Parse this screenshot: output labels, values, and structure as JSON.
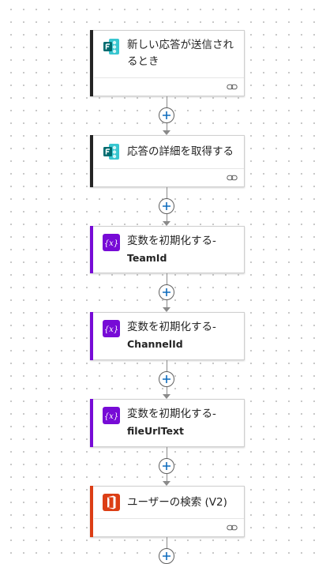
{
  "flow": {
    "steps": [
      {
        "title": "新しい応答が送信されるとき",
        "title_line1": "新しい応答が送信され",
        "title_line2": "るとき",
        "icon": "forms-icon",
        "accent": "#242424",
        "has_link": true
      },
      {
        "title": "応答の詳細を取得する",
        "title_line1": "応答の詳細を取得する",
        "title_line2": "",
        "icon": "forms-icon",
        "accent": "#242424",
        "has_link": true
      },
      {
        "title": "変数を初期化する-TeamId",
        "title_line1": "変数を初期化する-",
        "title_line2": "TeamId",
        "icon": "variable-icon",
        "accent": "#770bd6",
        "has_link": false
      },
      {
        "title": "変数を初期化する-ChannelId",
        "title_line1": "変数を初期化する-",
        "title_line2": "ChannelId",
        "icon": "variable-icon",
        "accent": "#770bd6",
        "has_link": false
      },
      {
        "title": "変数を初期化する-fileUrlText",
        "title_line1": "変数を初期化する-",
        "title_line2": "fileUrlText",
        "icon": "variable-icon",
        "accent": "#770bd6",
        "has_link": false
      },
      {
        "title": "ユーザーの検索 (V2)",
        "title_line1": "ユーザーの検索 (V2)",
        "title_line2": "",
        "icon": "office365-icon",
        "accent": "#dc3e15",
        "has_link": true
      }
    ],
    "colors": {
      "forms": "#036c70",
      "forms_light": "#37c6d0",
      "variable": "#770bd6",
      "office": "#dc3e15",
      "plus": "#0f6cbd",
      "connector": "#8a8a8a"
    },
    "icons": {
      "insert": "plus-icon",
      "link": "link-icon"
    }
  }
}
